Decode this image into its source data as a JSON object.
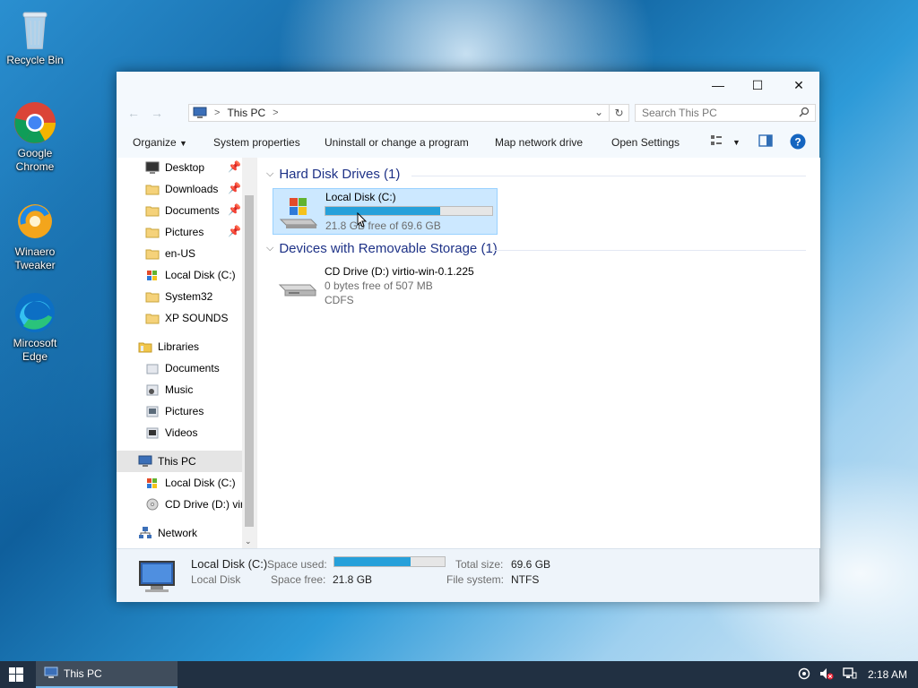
{
  "desktop": {
    "icons": [
      {
        "label": "Recycle Bin",
        "icon": "recycle-bin-icon"
      },
      {
        "label": "Google Chrome",
        "icon": "chrome-icon"
      },
      {
        "label": "Winaero Tweaker",
        "icon": "winaero-tweaker-icon"
      },
      {
        "label": "Mircosoft Edge",
        "icon": "edge-icon"
      }
    ]
  },
  "window": {
    "caption": {
      "minimize": "—",
      "maximize": "☐",
      "close": "✕"
    },
    "address": {
      "location": "This PC",
      "separator": ">",
      "refresh": "↻",
      "dropdown": "⌄"
    },
    "search": {
      "placeholder": "Search This PC"
    },
    "commands": {
      "organize": "Organize",
      "system_properties": "System properties",
      "uninstall": "Uninstall or change a program",
      "map_drive": "Map network drive",
      "open_settings": "Open Settings"
    },
    "nav": {
      "quick_access": [
        {
          "label": "Desktop",
          "pinned": true
        },
        {
          "label": "Downloads",
          "pinned": true
        },
        {
          "label": "Documents",
          "pinned": true
        },
        {
          "label": "Pictures",
          "pinned": true
        },
        {
          "label": "en-US",
          "pinned": false
        },
        {
          "label": "Local Disk (C:)",
          "pinned": false
        },
        {
          "label": "System32",
          "pinned": false
        },
        {
          "label": "XP SOUNDS",
          "pinned": false
        }
      ],
      "libraries": {
        "label": "Libraries",
        "items": [
          "Documents",
          "Music",
          "Pictures",
          "Videos"
        ]
      },
      "this_pc": {
        "label": "This PC",
        "items": [
          "Local Disk (C:)",
          "CD Drive (D:) virt"
        ]
      },
      "network": "Network"
    },
    "groups": {
      "hard_disk": {
        "title": "Hard Disk Drives (1)",
        "drive": {
          "name": "Local Disk (C:)",
          "free_text": "21.8 GB free of 69.6 GB",
          "used_fraction": 0.687
        }
      },
      "removable": {
        "title": "Devices with Removable Storage (1)",
        "drive": {
          "name": "CD Drive (D:) virtio-win-0.1.225",
          "free_text": "0 bytes free of 507 MB",
          "fs": "CDFS"
        }
      }
    },
    "details": {
      "name": "Local Disk (C:)",
      "type": "Local Disk",
      "space_used_label": "Space used:",
      "space_free_label": "Space free:",
      "space_free": "21.8 GB",
      "total_size_label": "Total size:",
      "total_size": "69.6 GB",
      "fs_label": "File system:",
      "fs": "NTFS",
      "used_fraction": 0.687
    }
  },
  "taskbar": {
    "start": "start-icon",
    "app_label": "This PC",
    "clock": "2:18 AM"
  },
  "colors": {
    "accent": "#26a0da",
    "selection": "#cce8ff",
    "group_title": "#1e3287"
  }
}
